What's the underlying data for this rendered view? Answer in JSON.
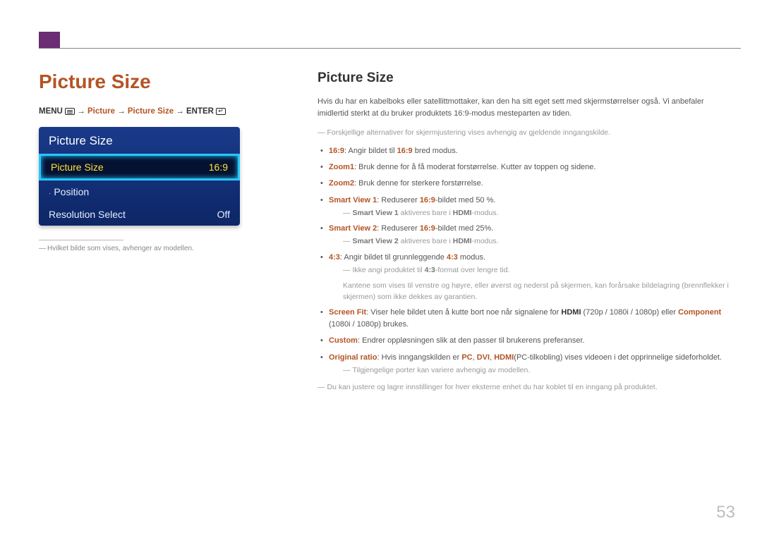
{
  "page_number": "53",
  "left": {
    "title": "Picture Size",
    "breadcrumb": {
      "menu_label": "MENU",
      "arrow": "→",
      "p1": "Picture",
      "p2": "Picture Size",
      "enter_label": "ENTER"
    },
    "osd": {
      "title": "Picture Size",
      "row_selected": {
        "label": "Picture Size",
        "value": "16:9"
      },
      "row_position": {
        "label": "Position"
      },
      "row_resolution": {
        "label": "Resolution Select",
        "value": "Off"
      }
    },
    "footnote": "Hvilket bilde som vises, avhenger av modellen."
  },
  "right": {
    "heading": "Picture Size",
    "intro": "Hvis du har en kabelboks eller satellittmottaker, kan den ha sitt eget sett med skjermstørrelser også. Vi anbefaler imidlertid sterkt at du bruker produktets 16:9-modus mesteparten av tiden.",
    "note_top": "Forskjellige alternativer for skjermjustering vises avhengig av gjeldende inngangskilde.",
    "items": {
      "i169": {
        "label": "16:9",
        "rest": ": Angir bildet til ",
        "label2": "16:9",
        "rest2": " bred modus."
      },
      "zoom1": {
        "label": "Zoom1",
        "rest": ": Bruk denne for å få moderat forstørrelse. Kutter av toppen og sidene."
      },
      "zoom2": {
        "label": "Zoom2",
        "rest": ": Bruk denne for sterkere forstørrelse."
      },
      "sv1": {
        "label": "Smart View 1",
        "rest": ": Reduserer ",
        "label2": "16:9",
        "rest2": "-bildet med 50 %."
      },
      "sv1_note": {
        "a": "Smart View 1",
        "mid": " aktiveres bare i ",
        "b": "HDMI",
        "end": "-modus."
      },
      "sv2": {
        "label": "Smart View 2",
        "rest": ": Reduserer ",
        "label2": "16:9",
        "rest2": "-bildet med 25%."
      },
      "sv2_note": {
        "a": "Smart View 2",
        "mid": " aktiveres bare i ",
        "b": "HDMI",
        "end": "-modus."
      },
      "i43": {
        "label": "4:3",
        "rest": ": Angir bildet til grunnleggende ",
        "label2": "4:3",
        "rest2": " modus."
      },
      "i43_note1": {
        "pre": "Ikke angi produktet til ",
        "b": "4:3",
        "post": "-format over lengre tid."
      },
      "i43_note2": "Kantene som vises til venstre og høyre, eller øverst og nederst på skjermen, kan forårsake bildelagring (brennflekker i skjermen) som ikke dekkes av garantien.",
      "screenfit": {
        "label": "Screen Fit",
        "pre": ": Viser hele bildet uten å kutte bort noe når signalene for ",
        "hdmi": "HDMI",
        "mid": " (720p / 1080i / 1080p) eller ",
        "component": "Component",
        "post": " (1080i / 1080p) brukes."
      },
      "custom": {
        "label": "Custom",
        "rest": ": Endrer oppløsningen slik at den passer til brukerens preferanser."
      },
      "original": {
        "label": "Original ratio",
        "pre": ": Hvis inngangskilden er ",
        "pc": "PC",
        "c1": ", ",
        "dvi": "DVI",
        "c2": ", ",
        "hdmi": "HDMI",
        "post": "(PC-tilkobling) vises videoen i det opprinnelige sideforholdet."
      },
      "ports_note": "Tilgjengelige porter kan variere avhengig av modellen.",
      "adjust_note": "Du kan justere og lagre innstillinger for hver eksterne enhet du har koblet til en inngang på produktet."
    }
  }
}
